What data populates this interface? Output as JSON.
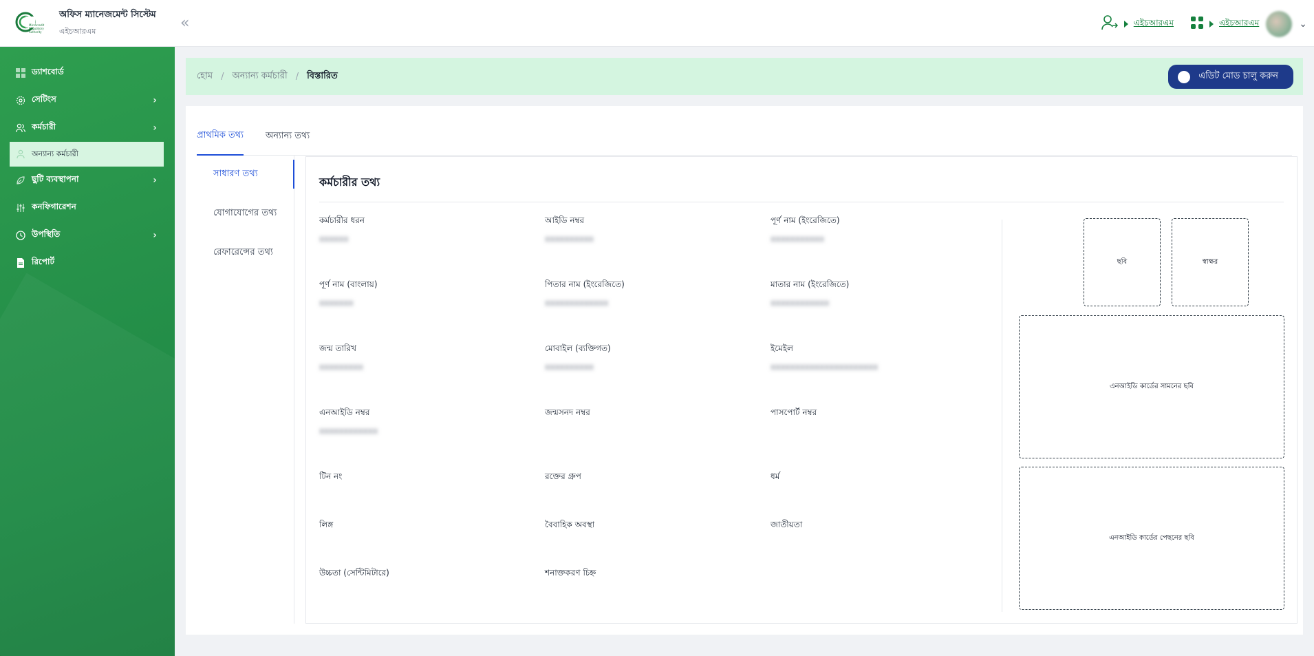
{
  "header": {
    "title": "অফিস ম্যানেজমেন্ট সিস্টেম",
    "subtitle": "এইচআরএম",
    "logo_text": [
      "Microcredit",
      "Regulatory",
      "Authority"
    ],
    "collapse_icon": "double-chevron-left-icon",
    "right_link_1": "এইচআরএম",
    "right_link_2": "এইচআরএম"
  },
  "sidebar": {
    "items": [
      {
        "label": "ড্যাশবোর্ড",
        "icon": "grid-icon"
      },
      {
        "label": "সেটিংস",
        "icon": "gear-icon"
      },
      {
        "label": "কর্মচারী",
        "icon": "users-icon"
      },
      {
        "label": "অন্যান্য কর্মচারী",
        "icon": "user-icon"
      },
      {
        "label": "ছুটি ব্যবস্থাপনা",
        "icon": "leaf-icon"
      },
      {
        "label": "কনফিগারেশন",
        "icon": "sliders-icon"
      },
      {
        "label": "উপস্থিতি",
        "icon": "clock-icon"
      },
      {
        "label": "রিপোর্ট",
        "icon": "file-icon"
      }
    ]
  },
  "breadcrumb": {
    "home": "হোম",
    "section": "অন্যান্য কর্মচারী",
    "current": "বিস্তারিত"
  },
  "edit_button": "এডিট মোড চালু করুন",
  "tabs": [
    "প্রাথমিক তথ্য",
    "অন্যান্য তথ্য"
  ],
  "subnav": [
    "সাধারণ তথ্য",
    "যোগাযোগের তথ্য",
    "রেফারেন্সের তথ্য"
  ],
  "panel": {
    "title": "কর্মচারীর তথ্য",
    "fields": [
      {
        "label": "কর্মচারীর ধরন",
        "value": "xxxxxx"
      },
      {
        "label": "আইডি নম্বর",
        "value": "xxxxxxxxxx"
      },
      {
        "label": "পূর্ণ নাম (ইংরেজিতে)",
        "value": "xxxxxxxxxxx"
      },
      {
        "label": "পূর্ণ নাম (বাংলায়)",
        "value": "xxxxxxx"
      },
      {
        "label": "পিতার নাম (ইংরেজিতে)",
        "value": "xxxxxxxxxxxxx"
      },
      {
        "label": "মাতার নাম (ইংরেজিতে)",
        "value": "xxxxxxxxxxxx"
      },
      {
        "label": "জন্ম তারিখ",
        "value": "xxxxxxxxx"
      },
      {
        "label": "মোবাইল (ব্যক্তিগত)",
        "value": "xxxxxxxxxx"
      },
      {
        "label": "ইমেইল",
        "value": "xxxxxxxxxxxxxxxxxxxxxx"
      },
      {
        "label": "এনআইডি নম্বর",
        "value": "xxxxxxxxxxxx"
      },
      {
        "label": "জন্মসনদ নম্বর",
        "value": ""
      },
      {
        "label": "পাসপোর্ট নম্বর",
        "value": ""
      },
      {
        "label": "টিন নং",
        "value": ""
      },
      {
        "label": "রক্তের গ্রুপ",
        "value": ""
      },
      {
        "label": "ধর্ম",
        "value": ""
      },
      {
        "label": "লিঙ্গ",
        "value": ""
      },
      {
        "label": "বৈবাহিক অবস্থা",
        "value": ""
      },
      {
        "label": "জাতীয়তা",
        "value": ""
      },
      {
        "label": "উচ্চতা (সেন্টিমিটারে)",
        "value": ""
      },
      {
        "label": "শনাক্তকরণ চিহ্ন",
        "value": ""
      }
    ],
    "photo_label": "ছবি",
    "signature_label": "স্বাক্ষর",
    "nid_front_label": "এনআইডি কার্ডের সামনের ছবি",
    "nid_back_label": "এনআইডি কার্ডের পেছনের ছবি"
  },
  "colors": {
    "sidebar_green": "#26914a",
    "active_blue": "#1d4ed8",
    "edit_button": "#1e3a8a",
    "breadcrumb_bg": "#d4f5e0",
    "link_green": "#15803d"
  }
}
